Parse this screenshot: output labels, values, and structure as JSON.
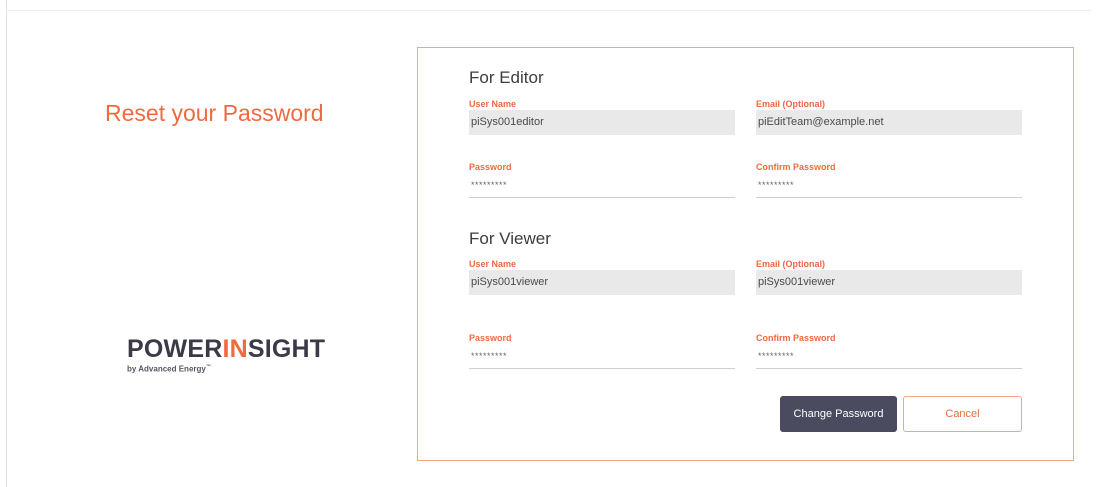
{
  "page": {
    "title": "Reset your Password"
  },
  "logo": {
    "part1": "POWER",
    "part2": "IN",
    "part3": "SIGHT",
    "tagline": "by Advanced Energy",
    "tm": "™"
  },
  "editor": {
    "heading": "For Editor",
    "username": {
      "label": "User Name",
      "value": "piSys001editor"
    },
    "email": {
      "label": "Email (Optional)",
      "value": "piEditTeam@example.net"
    },
    "password": {
      "label": "Password",
      "value": "*********"
    },
    "confirm": {
      "label": "Confirm Password",
      "value": "*********"
    }
  },
  "viewer": {
    "heading": "For Viewer",
    "username": {
      "label": "User Name",
      "value": "piSys001viewer"
    },
    "email": {
      "label": "Email (Optional)",
      "value": "piSys001viewer"
    },
    "password": {
      "label": "Password",
      "value": "*********"
    },
    "confirm": {
      "label": "Confirm Password",
      "value": "*********"
    }
  },
  "actions": {
    "change_password": "Change Password",
    "cancel": "Cancel"
  },
  "colors": {
    "accent": "#f06a3f",
    "button_dark": "#4a4b5f",
    "panel_border": "#f2a488"
  }
}
